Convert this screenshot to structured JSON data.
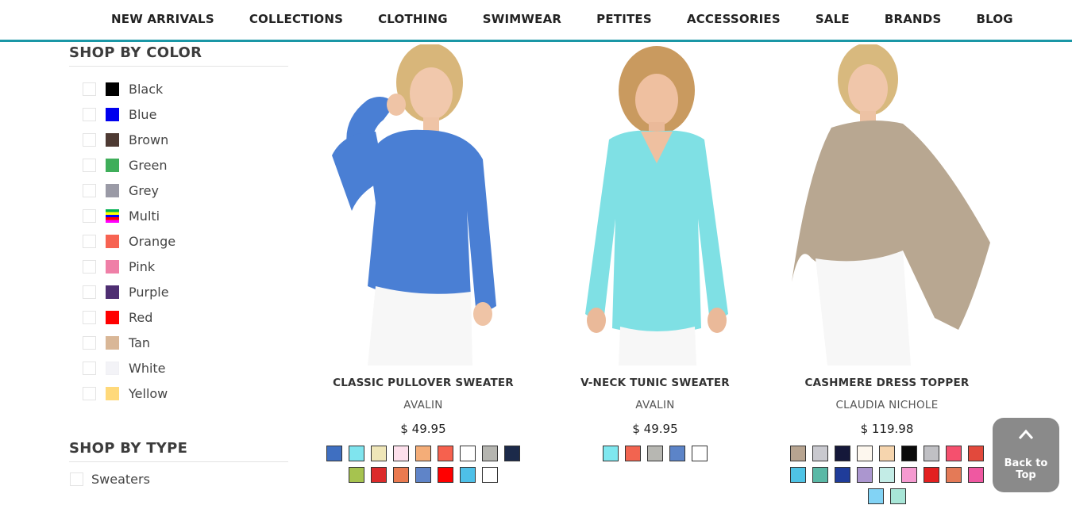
{
  "nav": {
    "items": [
      "NEW ARRIVALS",
      "COLLECTIONS",
      "CLOTHING",
      "SWIMWEAR",
      "PETITES",
      "ACCESSORIES",
      "SALE",
      "BRANDS",
      "BLOG"
    ]
  },
  "color_filter": {
    "title": "SHOP BY COLOR",
    "colors": [
      {
        "label": "Black",
        "hex": "#000000"
      },
      {
        "label": "Blue",
        "hex": "#0000ee"
      },
      {
        "label": "Brown",
        "hex": "#4e3a33"
      },
      {
        "label": "Green",
        "hex": "#3fae5a"
      },
      {
        "label": "Grey",
        "hex": "#9a9aa6"
      },
      {
        "label": "Multi",
        "hex": "multi"
      },
      {
        "label": "Orange",
        "hex": "#f76352"
      },
      {
        "label": "Pink",
        "hex": "#ef7fa7"
      },
      {
        "label": "Purple",
        "hex": "#4e2e72"
      },
      {
        "label": "Red",
        "hex": "#ff0000"
      },
      {
        "label": "Tan",
        "hex": "#d9b797"
      },
      {
        "label": "White",
        "hex": "#f3f3f7"
      },
      {
        "label": "Yellow",
        "hex": "#ffd97a"
      }
    ]
  },
  "type_filter": {
    "title": "SHOP BY TYPE",
    "types": [
      {
        "label": "Sweaters"
      }
    ]
  },
  "products": [
    {
      "name": "CLASSIC PULLOVER SWEATER",
      "brand": "AVALIN",
      "price": "$ 49.95",
      "garment_color": "#4a7fd4",
      "swatches": [
        "#3f6fc1",
        "#7fe4ee",
        "#efe6b8",
        "#fde0ec",
        "#f4ad78",
        "#f6614e",
        "#ffffff",
        "#b5b5b0",
        "#1c2a4a",
        "#a6c34f",
        "#dc2b2b",
        "#ea7a50",
        "#5f84c8",
        "#ff0000",
        "#4ec0e8",
        "#ffffff"
      ]
    },
    {
      "name": "V-NECK TUNIC SWEATER",
      "brand": "AVALIN",
      "price": "$ 49.95",
      "garment_color": "#7fe0e4",
      "swatches": [
        "#7fe7ef",
        "#f26450",
        "#b7b7b2",
        "#5c84c8",
        "#ffffff"
      ]
    },
    {
      "name": "CASHMERE DRESS TOPPER",
      "brand": "CLAUDIA NICHOLE",
      "price": "$ 119.98",
      "garment_color": "#b8a791",
      "swatches": [
        "#b7a490",
        "#c9c9cf",
        "#15183a",
        "#fdf7ee",
        "#f6d5ae",
        "#0a0a0a",
        "#c0c0c4",
        "#f5506e",
        "#e2493c",
        "#4fc3e5",
        "#5ab8a6",
        "#1f3c9a",
        "#ab96cf",
        "#c3ece6",
        "#f59ad0",
        "#e32020",
        "#e47a57",
        "#ef58a1",
        "#82d3f5",
        "#a8e6d7"
      ]
    }
  ],
  "back_to_top": {
    "label": "Back to Top"
  }
}
